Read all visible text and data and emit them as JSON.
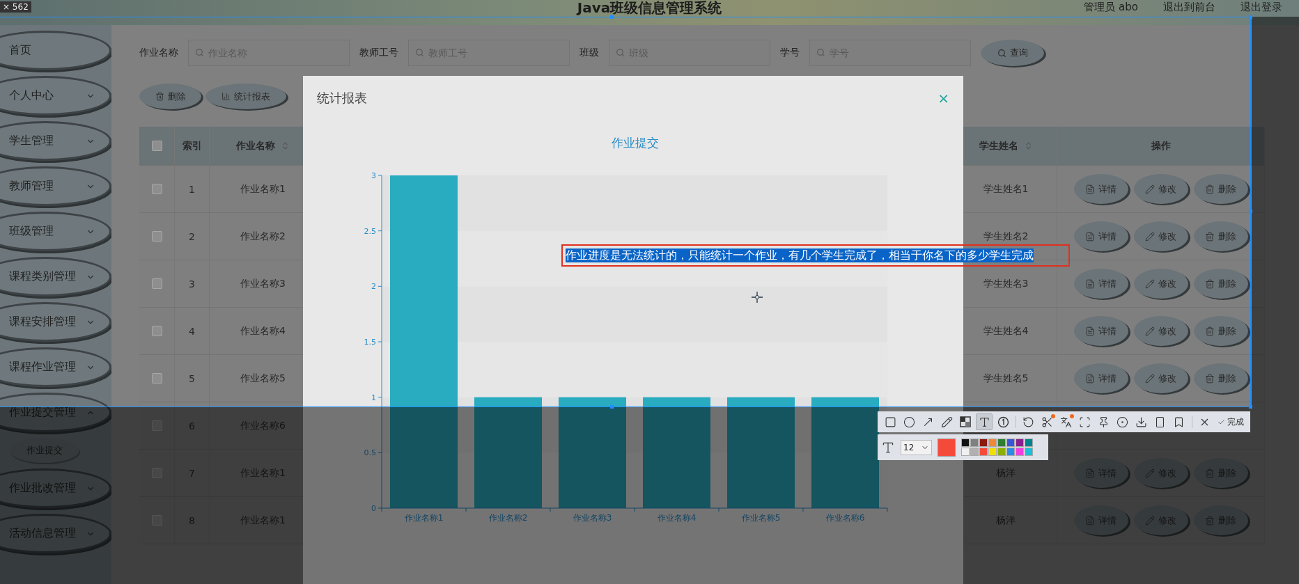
{
  "capture": {
    "size_label": "× 562"
  },
  "header": {
    "title": "Java班级信息管理系统",
    "links": [
      "管理员 abo",
      "退出到前台",
      "退出登录"
    ]
  },
  "sidebar": {
    "items": [
      {
        "label": "首页",
        "kind": "link"
      },
      {
        "label": "个人中心",
        "kind": "submenu",
        "expanded": false
      },
      {
        "label": "学生管理",
        "kind": "submenu",
        "expanded": false
      },
      {
        "label": "教师管理",
        "kind": "submenu",
        "expanded": false
      },
      {
        "label": "班级管理",
        "kind": "submenu",
        "expanded": false
      },
      {
        "label": "课程类别管理",
        "kind": "submenu",
        "expanded": false
      },
      {
        "label": "课程安排管理",
        "kind": "submenu",
        "expanded": false
      },
      {
        "label": "课程作业管理",
        "kind": "submenu",
        "expanded": false
      },
      {
        "label": "作业提交管理",
        "kind": "submenu",
        "expanded": true,
        "children": [
          {
            "label": "作业提交"
          }
        ]
      },
      {
        "label": "作业批改管理",
        "kind": "submenu",
        "expanded": false
      },
      {
        "label": "活动信息管理",
        "kind": "submenu",
        "expanded": false
      }
    ]
  },
  "filters": [
    {
      "label": "作业名称",
      "placeholder": "作业名称"
    },
    {
      "label": "教师工号",
      "placeholder": "教师工号"
    },
    {
      "label": "班级",
      "placeholder": "班级"
    },
    {
      "label": "学号",
      "placeholder": "学号"
    }
  ],
  "search_button": "查询",
  "actions": [
    {
      "kind": "delete",
      "label": "删除"
    },
    {
      "kind": "report",
      "label": "统计报表"
    }
  ],
  "table": {
    "all_checked": false,
    "columns": [
      {
        "kind": "checkbox"
      },
      {
        "kind": "index",
        "label": "索引",
        "sortable": false
      },
      {
        "kind": "name",
        "label": "作业名称",
        "sortable": true
      },
      {
        "kind": "student",
        "label": "学生姓名",
        "sortable": true
      },
      {
        "kind": "actions",
        "label": "操作",
        "sortable": false
      }
    ],
    "rows": [
      {
        "index": "1",
        "name": "作业名称1",
        "student": "学生姓名1",
        "checked": false,
        "actions": [
          {
            "kind": "detail",
            "label": "详情"
          },
          {
            "kind": "edit",
            "label": "修改"
          },
          {
            "kind": "delete",
            "label": "删除"
          }
        ]
      },
      {
        "index": "2",
        "name": "作业名称2",
        "student": "学生姓名2",
        "checked": false,
        "actions": [
          {
            "kind": "detail",
            "label": "详情"
          },
          {
            "kind": "edit",
            "label": "修改"
          },
          {
            "kind": "delete",
            "label": "删除"
          }
        ]
      },
      {
        "index": "3",
        "name": "作业名称3",
        "student": "学生姓名3",
        "checked": false,
        "actions": [
          {
            "kind": "detail",
            "label": "详情"
          },
          {
            "kind": "edit",
            "label": "修改"
          },
          {
            "kind": "delete",
            "label": "删除"
          }
        ]
      },
      {
        "index": "4",
        "name": "作业名称4",
        "student": "学生姓名4",
        "checked": false,
        "actions": [
          {
            "kind": "detail",
            "label": "详情"
          },
          {
            "kind": "edit",
            "label": "修改"
          },
          {
            "kind": "delete",
            "label": "删除"
          }
        ]
      },
      {
        "index": "5",
        "name": "作业名称5",
        "student": "学生姓名5",
        "checked": false,
        "actions": [
          {
            "kind": "detail",
            "label": "详情"
          },
          {
            "kind": "edit",
            "label": "修改"
          },
          {
            "kind": "delete",
            "label": "删除"
          }
        ]
      },
      {
        "index": "6",
        "name": "作业名称6",
        "checked": false
      },
      {
        "index": "7",
        "name": "作业名称1",
        "student": "杨洋",
        "checked": false,
        "actions": [
          {
            "kind": "detail",
            "label": "详情"
          },
          {
            "kind": "edit",
            "label": "修改"
          },
          {
            "kind": "delete",
            "label": "删除"
          }
        ]
      },
      {
        "index": "8",
        "name": "作业名称1",
        "student": "杨洋",
        "checked": false,
        "actions": [
          {
            "kind": "detail",
            "label": "详情"
          },
          {
            "kind": "edit",
            "label": "修改"
          },
          {
            "kind": "delete",
            "label": "删除"
          }
        ]
      }
    ]
  },
  "modal": {
    "title": "统计报表",
    "close": "×",
    "chart_data": {
      "type": "bar",
      "title": "作业提交",
      "categories": [
        "作业名称1",
        "作业名称2",
        "作业名称3",
        "作业名称4",
        "作业名称5",
        "作业名称6"
      ],
      "series": [
        {
          "color": "#29abc0",
          "values": [
            3,
            1,
            1,
            1,
            1,
            1
          ]
        }
      ],
      "ylim": [
        0,
        3
      ],
      "yticks": [
        0,
        0.5,
        1,
        1.5,
        2,
        2.5,
        3
      ]
    }
  },
  "annotation": {
    "text": "作业进度是无法统计的，只能统计一个作业，有几个学生完成了，相当于你名下的多少学生完成",
    "selected": true
  },
  "toolbar": {
    "tools": [
      {
        "kind": "rectangle",
        "selected": false,
        "badge": false
      },
      {
        "kind": "ellipse",
        "selected": false,
        "badge": false
      },
      {
        "kind": "arrow",
        "selected": false,
        "badge": false
      },
      {
        "kind": "pencil",
        "selected": false,
        "badge": false
      },
      {
        "kind": "mosaic",
        "selected": false,
        "badge": false
      },
      {
        "kind": "text",
        "selected": true,
        "badge": false
      },
      {
        "kind": "counter",
        "selected": false,
        "badge": false
      },
      {
        "kind": "separator"
      },
      {
        "kind": "undo",
        "selected": false,
        "badge": false
      },
      {
        "kind": "cut",
        "selected": false,
        "badge": true
      },
      {
        "kind": "translate",
        "selected": false,
        "badge": true
      },
      {
        "kind": "scan",
        "selected": false,
        "badge": false
      },
      {
        "kind": "pin",
        "selected": false,
        "badge": false
      },
      {
        "kind": "record",
        "selected": false,
        "badge": false
      },
      {
        "kind": "download",
        "selected": false,
        "badge": false
      },
      {
        "kind": "phone",
        "selected": false,
        "badge": false
      },
      {
        "kind": "bookmark",
        "selected": false,
        "badge": false
      },
      {
        "kind": "separator"
      },
      {
        "kind": "cancel",
        "selected": false,
        "badge": false
      },
      {
        "kind": "done",
        "selected": false,
        "badge": false,
        "label": "完成"
      }
    ],
    "font_size": "12",
    "current_color": {
      "color": "#f44a3a"
    },
    "palette": [
      {
        "color": "#111111"
      },
      {
        "color": "#808080"
      },
      {
        "color": "#8b1a10"
      },
      {
        "color": "#f0883a"
      },
      {
        "color": "#2e7d32"
      },
      {
        "color": "#3a56d4"
      },
      {
        "color": "#8a1f8e"
      },
      {
        "color": "#00838f"
      },
      {
        "color": "#f0f0f0"
      },
      {
        "color": "#b0b0b0"
      },
      {
        "color": "#f44a3a"
      },
      {
        "color": "#f0e000"
      },
      {
        "color": "#8ab000"
      },
      {
        "color": "#2d8ae6"
      },
      {
        "color": "#f040e0"
      },
      {
        "color": "#18c0d8"
      }
    ]
  }
}
